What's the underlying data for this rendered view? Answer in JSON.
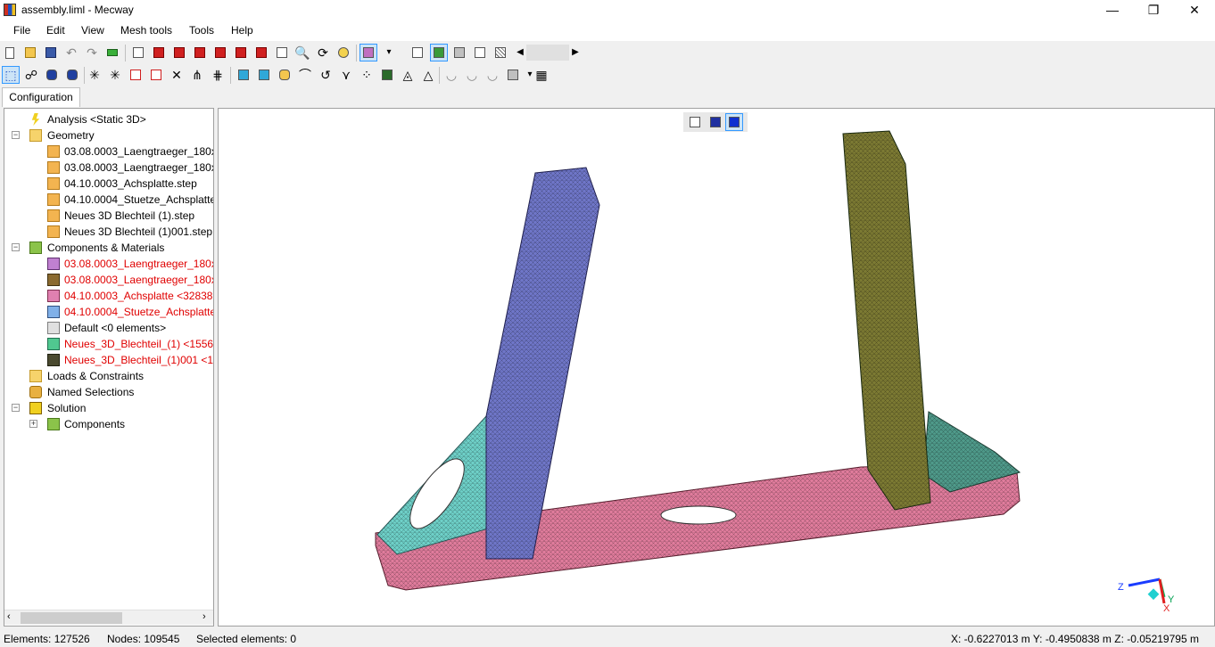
{
  "window": {
    "title": "assembly.liml - Mecway",
    "minimize": "—",
    "maximize": "❐",
    "close": "✕"
  },
  "menu": [
    "File",
    "Edit",
    "View",
    "Mesh tools",
    "Tools",
    "Help"
  ],
  "tabs": {
    "configuration": "Configuration"
  },
  "tree": {
    "analysis": "Analysis <Static 3D>",
    "geometry": "Geometry",
    "geometry_items": [
      "03.08.0003_Laengtraeger_180x120",
      "03.08.0003_Laengtraeger_180x120",
      "04.10.0003_Achsplatte.step",
      "04.10.0004_Stuetze_Achsplatte.st",
      "Neues 3D Blechteil (1).step",
      "Neues 3D Blechteil (1)001.step"
    ],
    "components": "Components & Materials",
    "component_items": [
      "03.08.0003_Laengtraeger_180x120",
      "03.08.0003_Laengtraeger_180x120",
      "04.10.0003_Achsplatte <32838 el",
      "04.10.0004_Stuetze_Achsplatte <",
      "Default <0 elements>",
      "Neues_3D_Blechteil_(1) <1556 el",
      "Neues_3D_Blechteil_(1)001 <153"
    ],
    "loads": "Loads & Constraints",
    "named_selections": "Named Selections",
    "solution": "Solution",
    "solution_components": "Components"
  },
  "status": {
    "elements": "Elements: 127526",
    "nodes": "Nodes: 109545",
    "selected": "Selected elements: 0",
    "coords": "X: -0.6227013 m Y: -0.4950838 m Z: -0.05219795 m"
  },
  "axis": {
    "x": "X",
    "y": "Y",
    "z": "Z"
  },
  "colors": {
    "beam_left": "#6f76c8",
    "beam_right": "#7c7a33",
    "plate": "#e07c9c",
    "bracket": "#6ed0c8"
  }
}
